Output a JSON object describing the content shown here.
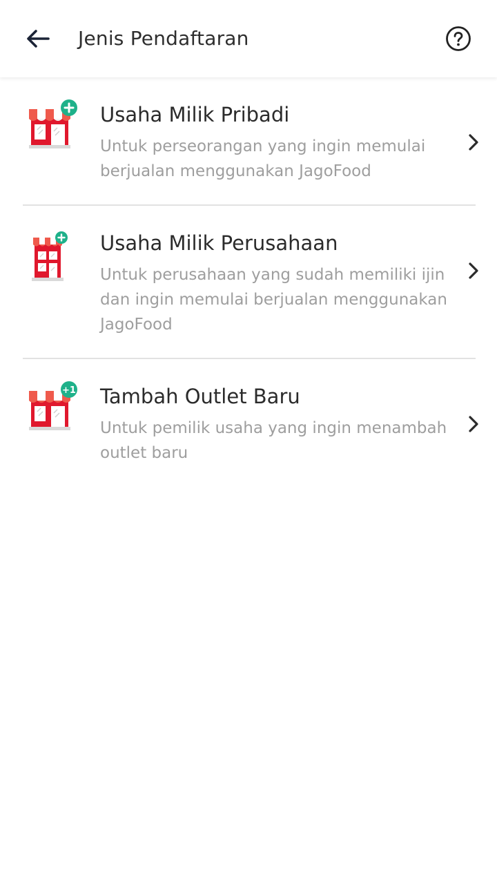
{
  "header": {
    "title": "Jenis Pendaftaran",
    "back_icon": "arrow-left-icon",
    "help_icon": "question-circle-icon"
  },
  "options": [
    {
      "title": "Usaha Milik Pribadi",
      "description": "Untuk perseorangan yang ingin memulai berjualan menggunakan JagoFood",
      "icon": "store-add-icon"
    },
    {
      "title": "Usaha Milik Perusahaan",
      "description": "Untuk perusahaan yang sudah memiliki ijin dan ingin memulai berjualan menggunakan JagoFood",
      "icon": "building-add-icon"
    },
    {
      "title": "Tambah Outlet Baru",
      "description": "Untuk pemilik usaha yang ingin menambah outlet baru",
      "icon": "store-plus-one-icon",
      "badge": "+1"
    }
  ],
  "colors": {
    "brand_red": "#e0182d",
    "awning_red": "#ef5a4c",
    "badge_green": "#1fb18a",
    "text_primary": "#2b2b2b",
    "text_secondary": "#9e9e9e",
    "divider": "#e2e2e2"
  }
}
